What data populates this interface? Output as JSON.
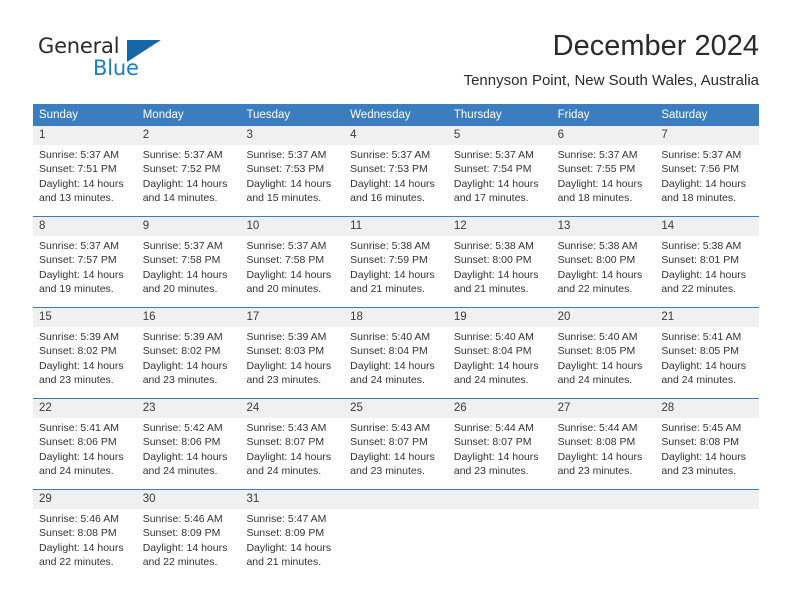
{
  "brand": {
    "word_one": "General",
    "word_two": "Blue",
    "triangle_color": "#1567a8",
    "blue_text_color": "#1a7ec4"
  },
  "header": {
    "title": "December 2024",
    "subtitle": "Tennyson Point, New South Wales, Australia"
  },
  "theme": {
    "header_row_bg": "#3b7dbf",
    "header_row_text": "#ffffff",
    "daynum_band_bg": "#f0f0f0",
    "cell_bg": "#ffffff",
    "rule_color": "#3b7dbf"
  },
  "weekdays": [
    "Sunday",
    "Monday",
    "Tuesday",
    "Wednesday",
    "Thursday",
    "Friday",
    "Saturday"
  ],
  "weeks": [
    {
      "days": [
        {
          "num": "1",
          "sunrise": "Sunrise: 5:37 AM",
          "sunset": "Sunset: 7:51 PM",
          "daylight1": "Daylight: 14 hours",
          "daylight2": "and 13 minutes."
        },
        {
          "num": "2",
          "sunrise": "Sunrise: 5:37 AM",
          "sunset": "Sunset: 7:52 PM",
          "daylight1": "Daylight: 14 hours",
          "daylight2": "and 14 minutes."
        },
        {
          "num": "3",
          "sunrise": "Sunrise: 5:37 AM",
          "sunset": "Sunset: 7:53 PM",
          "daylight1": "Daylight: 14 hours",
          "daylight2": "and 15 minutes."
        },
        {
          "num": "4",
          "sunrise": "Sunrise: 5:37 AM",
          "sunset": "Sunset: 7:53 PM",
          "daylight1": "Daylight: 14 hours",
          "daylight2": "and 16 minutes."
        },
        {
          "num": "5",
          "sunrise": "Sunrise: 5:37 AM",
          "sunset": "Sunset: 7:54 PM",
          "daylight1": "Daylight: 14 hours",
          "daylight2": "and 17 minutes."
        },
        {
          "num": "6",
          "sunrise": "Sunrise: 5:37 AM",
          "sunset": "Sunset: 7:55 PM",
          "daylight1": "Daylight: 14 hours",
          "daylight2": "and 18 minutes."
        },
        {
          "num": "7",
          "sunrise": "Sunrise: 5:37 AM",
          "sunset": "Sunset: 7:56 PM",
          "daylight1": "Daylight: 14 hours",
          "daylight2": "and 18 minutes."
        }
      ]
    },
    {
      "days": [
        {
          "num": "8",
          "sunrise": "Sunrise: 5:37 AM",
          "sunset": "Sunset: 7:57 PM",
          "daylight1": "Daylight: 14 hours",
          "daylight2": "and 19 minutes."
        },
        {
          "num": "9",
          "sunrise": "Sunrise: 5:37 AM",
          "sunset": "Sunset: 7:58 PM",
          "daylight1": "Daylight: 14 hours",
          "daylight2": "and 20 minutes."
        },
        {
          "num": "10",
          "sunrise": "Sunrise: 5:37 AM",
          "sunset": "Sunset: 7:58 PM",
          "daylight1": "Daylight: 14 hours",
          "daylight2": "and 20 minutes."
        },
        {
          "num": "11",
          "sunrise": "Sunrise: 5:38 AM",
          "sunset": "Sunset: 7:59 PM",
          "daylight1": "Daylight: 14 hours",
          "daylight2": "and 21 minutes."
        },
        {
          "num": "12",
          "sunrise": "Sunrise: 5:38 AM",
          "sunset": "Sunset: 8:00 PM",
          "daylight1": "Daylight: 14 hours",
          "daylight2": "and 21 minutes."
        },
        {
          "num": "13",
          "sunrise": "Sunrise: 5:38 AM",
          "sunset": "Sunset: 8:00 PM",
          "daylight1": "Daylight: 14 hours",
          "daylight2": "and 22 minutes."
        },
        {
          "num": "14",
          "sunrise": "Sunrise: 5:38 AM",
          "sunset": "Sunset: 8:01 PM",
          "daylight1": "Daylight: 14 hours",
          "daylight2": "and 22 minutes."
        }
      ]
    },
    {
      "days": [
        {
          "num": "15",
          "sunrise": "Sunrise: 5:39 AM",
          "sunset": "Sunset: 8:02 PM",
          "daylight1": "Daylight: 14 hours",
          "daylight2": "and 23 minutes."
        },
        {
          "num": "16",
          "sunrise": "Sunrise: 5:39 AM",
          "sunset": "Sunset: 8:02 PM",
          "daylight1": "Daylight: 14 hours",
          "daylight2": "and 23 minutes."
        },
        {
          "num": "17",
          "sunrise": "Sunrise: 5:39 AM",
          "sunset": "Sunset: 8:03 PM",
          "daylight1": "Daylight: 14 hours",
          "daylight2": "and 23 minutes."
        },
        {
          "num": "18",
          "sunrise": "Sunrise: 5:40 AM",
          "sunset": "Sunset: 8:04 PM",
          "daylight1": "Daylight: 14 hours",
          "daylight2": "and 24 minutes."
        },
        {
          "num": "19",
          "sunrise": "Sunrise: 5:40 AM",
          "sunset": "Sunset: 8:04 PM",
          "daylight1": "Daylight: 14 hours",
          "daylight2": "and 24 minutes."
        },
        {
          "num": "20",
          "sunrise": "Sunrise: 5:40 AM",
          "sunset": "Sunset: 8:05 PM",
          "daylight1": "Daylight: 14 hours",
          "daylight2": "and 24 minutes."
        },
        {
          "num": "21",
          "sunrise": "Sunrise: 5:41 AM",
          "sunset": "Sunset: 8:05 PM",
          "daylight1": "Daylight: 14 hours",
          "daylight2": "and 24 minutes."
        }
      ]
    },
    {
      "days": [
        {
          "num": "22",
          "sunrise": "Sunrise: 5:41 AM",
          "sunset": "Sunset: 8:06 PM",
          "daylight1": "Daylight: 14 hours",
          "daylight2": "and 24 minutes."
        },
        {
          "num": "23",
          "sunrise": "Sunrise: 5:42 AM",
          "sunset": "Sunset: 8:06 PM",
          "daylight1": "Daylight: 14 hours",
          "daylight2": "and 24 minutes."
        },
        {
          "num": "24",
          "sunrise": "Sunrise: 5:43 AM",
          "sunset": "Sunset: 8:07 PM",
          "daylight1": "Daylight: 14 hours",
          "daylight2": "and 24 minutes."
        },
        {
          "num": "25",
          "sunrise": "Sunrise: 5:43 AM",
          "sunset": "Sunset: 8:07 PM",
          "daylight1": "Daylight: 14 hours",
          "daylight2": "and 23 minutes."
        },
        {
          "num": "26",
          "sunrise": "Sunrise: 5:44 AM",
          "sunset": "Sunset: 8:07 PM",
          "daylight1": "Daylight: 14 hours",
          "daylight2": "and 23 minutes."
        },
        {
          "num": "27",
          "sunrise": "Sunrise: 5:44 AM",
          "sunset": "Sunset: 8:08 PM",
          "daylight1": "Daylight: 14 hours",
          "daylight2": "and 23 minutes."
        },
        {
          "num": "28",
          "sunrise": "Sunrise: 5:45 AM",
          "sunset": "Sunset: 8:08 PM",
          "daylight1": "Daylight: 14 hours",
          "daylight2": "and 23 minutes."
        }
      ]
    },
    {
      "days": [
        {
          "num": "29",
          "sunrise": "Sunrise: 5:46 AM",
          "sunset": "Sunset: 8:08 PM",
          "daylight1": "Daylight: 14 hours",
          "daylight2": "and 22 minutes."
        },
        {
          "num": "30",
          "sunrise": "Sunrise: 5:46 AM",
          "sunset": "Sunset: 8:09 PM",
          "daylight1": "Daylight: 14 hours",
          "daylight2": "and 22 minutes."
        },
        {
          "num": "31",
          "sunrise": "Sunrise: 5:47 AM",
          "sunset": "Sunset: 8:09 PM",
          "daylight1": "Daylight: 14 hours",
          "daylight2": "and 21 minutes."
        },
        {
          "num": "",
          "sunrise": "",
          "sunset": "",
          "daylight1": "",
          "daylight2": ""
        },
        {
          "num": "",
          "sunrise": "",
          "sunset": "",
          "daylight1": "",
          "daylight2": ""
        },
        {
          "num": "",
          "sunrise": "",
          "sunset": "",
          "daylight1": "",
          "daylight2": ""
        },
        {
          "num": "",
          "sunrise": "",
          "sunset": "",
          "daylight1": "",
          "daylight2": ""
        }
      ]
    }
  ]
}
